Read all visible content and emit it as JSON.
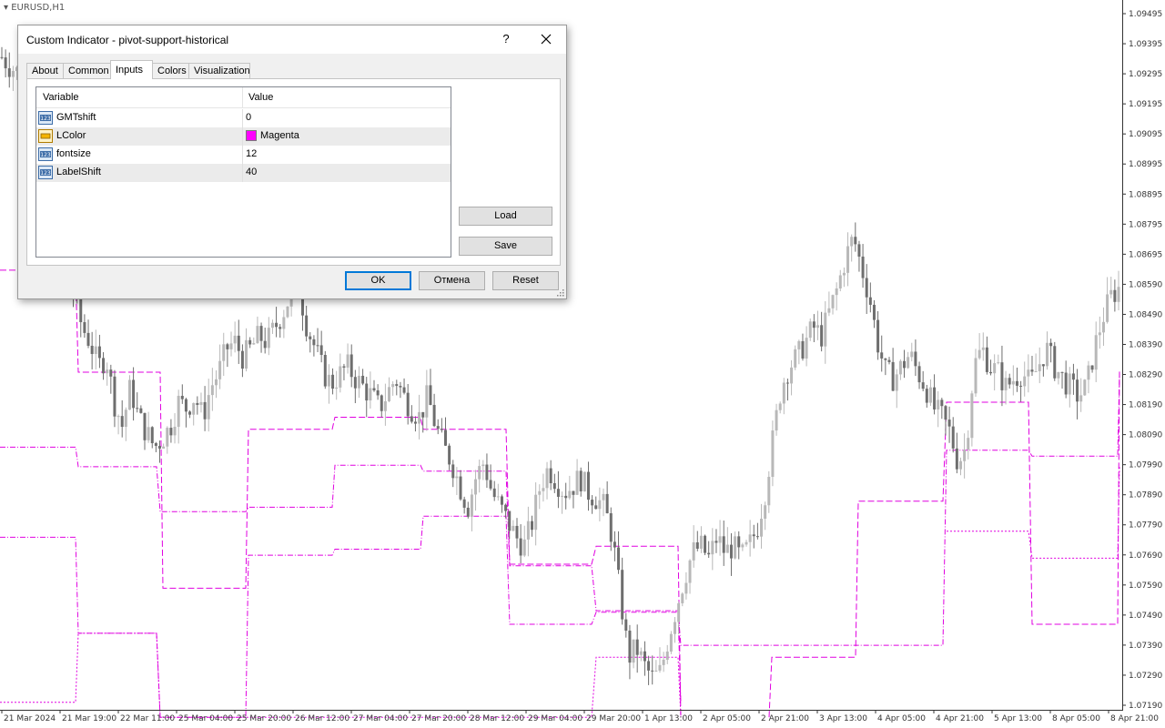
{
  "chart": {
    "symbol": "EURUSD,H1",
    "price_labels": [
      "1.09495",
      "1.09395",
      "1.09295",
      "1.09195",
      "1.09095",
      "1.08995",
      "1.08895",
      "1.08795",
      "1.08695",
      "1.08590",
      "1.08490",
      "1.08390",
      "1.08290",
      "1.08190",
      "1.08090",
      "1.07990",
      "1.07890",
      "1.07790",
      "1.07690",
      "1.07590",
      "1.07490",
      "1.07390",
      "1.07290",
      "1.07190"
    ],
    "time_labels": [
      "21 Mar 2024",
      "21 Mar 19:00",
      "22 Mar 11:00",
      "25 Mar 04:00",
      "25 Mar 20:00",
      "26 Mar 12:00",
      "27 Mar 04:00",
      "27 Mar 20:00",
      "28 Mar 12:00",
      "29 Mar 04:00",
      "29 Mar 20:00",
      "1 Apr 13:00",
      "2 Apr 05:00",
      "2 Apr 21:00",
      "3 Apr 13:00",
      "4 Apr 05:00",
      "4 Apr 21:00",
      "5 Apr 13:00",
      "8 Apr 05:00",
      "8 Apr 21:00"
    ],
    "colors": {
      "bull": "#b8b8b8",
      "bear": "#6e6e6e",
      "indicator": "#e000e0",
      "grid_text": "#333333"
    },
    "price_path": [
      1.0935,
      1.0932,
      1.093,
      1.0926,
      1.0918,
      1.0905,
      1.089,
      1.088,
      1.0868,
      1.0855,
      1.0845,
      1.084,
      1.0832,
      1.0835,
      1.082,
      1.0812,
      1.0825,
      1.0815,
      1.081,
      1.0805,
      1.0808,
      1.0812,
      1.082,
      1.0818,
      1.0822,
      1.0815,
      1.0825,
      1.083,
      1.0838,
      1.084,
      1.0835,
      1.0838,
      1.0842,
      1.084,
      1.0845,
      1.085,
      1.0856,
      1.0858,
      1.0845,
      1.0838,
      1.083,
      1.0826,
      1.0829,
      1.0832,
      1.0828,
      1.0825,
      1.0822,
      1.0818,
      1.0823,
      1.0828,
      1.0822,
      1.0818,
      1.0815,
      1.0822,
      1.0812,
      1.0805,
      1.08,
      1.0792,
      1.0785,
      1.0795,
      1.08,
      1.079,
      1.0785,
      1.078,
      1.0775,
      1.0772,
      1.078,
      1.0792,
      1.0798,
      1.0794,
      1.079,
      1.0792,
      1.0795,
      1.079,
      1.0788,
      1.0785,
      1.0775,
      1.0755,
      1.0735,
      1.0738,
      1.0732,
      1.0728,
      1.073,
      1.0742,
      1.0752,
      1.0762,
      1.077,
      1.0772,
      1.0768,
      1.0775,
      1.077,
      1.0772,
      1.0768,
      1.0772,
      1.0778,
      1.079,
      1.0808,
      1.0825,
      1.0832,
      1.0835,
      1.084,
      1.0845,
      1.0842,
      1.085,
      1.0858,
      1.0868,
      1.0875,
      1.0865,
      1.0855,
      1.084,
      1.083,
      1.0828,
      1.0832,
      1.0836,
      1.083,
      1.0825,
      1.0818,
      1.0815,
      1.081,
      1.08,
      1.0805,
      1.0832,
      1.0838,
      1.0832,
      1.083,
      1.0825,
      1.0828,
      1.083,
      1.0826,
      1.0832,
      1.0838,
      1.0832,
      1.0828,
      1.0825,
      1.0822,
      1.0825,
      1.0838,
      1.0848,
      1.0855,
      1.0858
    ],
    "levels": [
      {
        "style": "dashdot",
        "pts": [
          [
            0,
            1.0805
          ],
          [
            83,
            1.0805
          ],
          [
            86,
            1.07985
          ],
          [
            172,
            1.07985
          ],
          [
            176,
            1.07835
          ],
          [
            270,
            1.07835
          ],
          [
            273,
            1.0785
          ],
          [
            365,
            1.0785
          ],
          [
            368,
            1.0799
          ],
          [
            462,
            1.0799
          ],
          [
            465,
            1.0797
          ],
          [
            556,
            1.0797
          ],
          [
            560,
            1.07655
          ],
          [
            650,
            1.07655
          ],
          [
            655,
            1.07505
          ],
          [
            745,
            1.07505
          ],
          [
            748,
            1.0739
          ],
          [
            940,
            1.0739
          ],
          [
            943,
            1.0739
          ],
          [
            1036,
            1.0739
          ],
          [
            1040,
            1.0804
          ],
          [
            1130,
            1.0804
          ],
          [
            1134,
            1.0802
          ],
          [
            1228,
            1.0802
          ],
          [
            1230,
            1.0829
          ]
        ]
      },
      {
        "style": "dashdot",
        "pts": [
          [
            0,
            1.0775
          ],
          [
            83,
            1.0775
          ],
          [
            86,
            1.0743
          ],
          [
            172,
            1.0743
          ],
          [
            176,
            1.0715
          ],
          [
            270,
            1.0715
          ],
          [
            273,
            1.0769
          ],
          [
            365,
            1.0769
          ],
          [
            368,
            1.0771
          ],
          [
            462,
            1.0771
          ],
          [
            465,
            1.0782
          ],
          [
            556,
            1.0782
          ],
          [
            560,
            1.0746
          ],
          [
            650,
            1.0746
          ],
          [
            655,
            1.075
          ],
          [
            745,
            1.075
          ],
          [
            748,
            1.072
          ]
        ]
      },
      {
        "style": "dash",
        "pts": [
          [
            0,
            1.0864
          ],
          [
            83,
            1.0864
          ],
          [
            86,
            1.083
          ],
          [
            176,
            1.083
          ],
          [
            179,
            1.0758
          ],
          [
            270,
            1.0758
          ],
          [
            273,
            1.0811
          ],
          [
            365,
            1.0811
          ],
          [
            368,
            1.0815
          ],
          [
            462,
            1.0815
          ],
          [
            465,
            1.0811
          ],
          [
            556,
            1.0811
          ],
          [
            560,
            1.0766
          ],
          [
            650,
            1.0766
          ],
          [
            655,
            1.0772
          ],
          [
            745,
            1.0772
          ],
          [
            748,
            1.0715
          ]
        ]
      },
      {
        "style": "dash",
        "pts": [
          [
            845,
            1.0715
          ],
          [
            848,
            1.0735
          ],
          [
            940,
            1.0735
          ],
          [
            943,
            1.0787
          ],
          [
            1036,
            1.0787
          ],
          [
            1040,
            1.082
          ],
          [
            1130,
            1.082
          ],
          [
            1134,
            1.0746
          ],
          [
            1228,
            1.0746
          ],
          [
            1230,
            1.0831
          ]
        ]
      },
      {
        "style": "dot",
        "pts": [
          [
            0,
            1.072
          ],
          [
            83,
            1.072
          ],
          [
            86,
            1.0743
          ],
          [
            172,
            1.0743
          ],
          [
            176,
            1.0715
          ],
          [
            270,
            1.0715
          ],
          [
            273,
            1.0715
          ],
          [
            556,
            1.0715
          ],
          [
            560,
            1.0715
          ],
          [
            650,
            1.0715
          ],
          [
            655,
            1.0735
          ],
          [
            745,
            1.0735
          ],
          [
            748,
            1.0715
          ]
        ]
      },
      {
        "style": "dot",
        "pts": [
          [
            1040,
            1.0777
          ],
          [
            1130,
            1.0777
          ],
          [
            1134,
            1.0768
          ],
          [
            1228,
            1.0768
          ],
          [
            1230,
            1.0799
          ]
        ]
      }
    ]
  },
  "dialog": {
    "title": "Custom Indicator - pivot-support-historical",
    "help": "?",
    "tabs": [
      "About",
      "Common",
      "Inputs",
      "Colors",
      "Visualization"
    ],
    "active_tab": "Inputs",
    "grid": {
      "columns": [
        "Variable",
        "Value"
      ],
      "rows": [
        {
          "icon": "numeric-param-icon",
          "name": "GMTshift",
          "value": "0"
        },
        {
          "icon": "color-param-icon",
          "name": "LColor",
          "value": "Magenta",
          "swatch": "#ff00ff"
        },
        {
          "icon": "numeric-param-icon",
          "name": "fontsize",
          "value": "12"
        },
        {
          "icon": "numeric-param-icon",
          "name": "LabelShift",
          "value": "40"
        }
      ]
    },
    "buttons": {
      "load": "Load",
      "save": "Save",
      "ok": "OK",
      "cancel": "Отмена",
      "reset": "Reset"
    }
  }
}
